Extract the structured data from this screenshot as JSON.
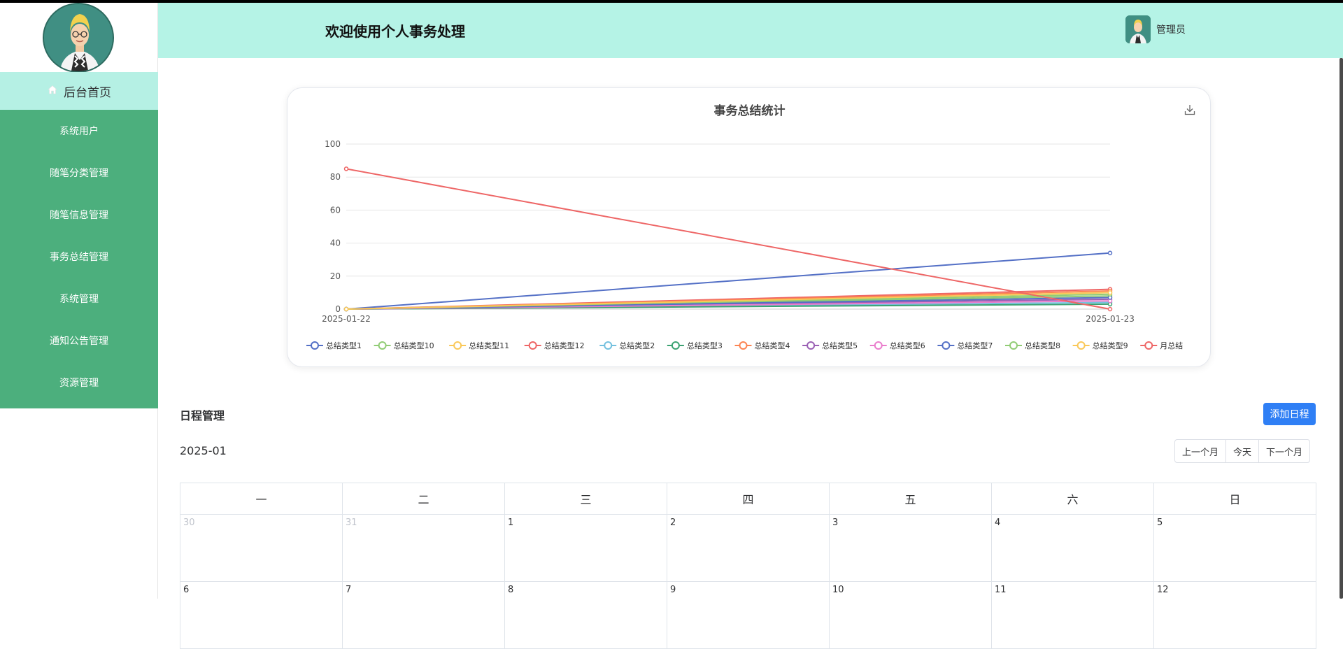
{
  "sidebar": {
    "home_label": "后台首页",
    "items": [
      {
        "label": "系统用户"
      },
      {
        "label": "随笔分类管理"
      },
      {
        "label": "随笔信息管理"
      },
      {
        "label": "事务总结管理"
      },
      {
        "label": "系统管理"
      },
      {
        "label": "通知公告管理"
      },
      {
        "label": "资源管理"
      }
    ]
  },
  "header": {
    "title": "欢迎使用个人事务处理",
    "user_name": "管理员"
  },
  "chart_data": {
    "type": "line",
    "title": "事务总结统计",
    "x": [
      "2025-01-22",
      "2025-01-23"
    ],
    "ylim": [
      0,
      100
    ],
    "yticks": [
      0,
      20,
      40,
      60,
      80,
      100
    ],
    "grid": true,
    "legend_position": "bottom",
    "series": [
      {
        "name": "总结类型1",
        "values": [
          0,
          34
        ],
        "color": "#5470c6"
      },
      {
        "name": "总结类型10",
        "values": [
          0,
          8
        ],
        "color": "#91cc75"
      },
      {
        "name": "总结类型11",
        "values": [
          0,
          10
        ],
        "color": "#fac858"
      },
      {
        "name": "总结类型12",
        "values": [
          0,
          12
        ],
        "color": "#ee6666"
      },
      {
        "name": "总结类型2",
        "values": [
          0,
          4
        ],
        "color": "#73c0de"
      },
      {
        "name": "总结类型3",
        "values": [
          0,
          3
        ],
        "color": "#3ba272"
      },
      {
        "name": "总结类型4",
        "values": [
          0,
          11
        ],
        "color": "#fc8452"
      },
      {
        "name": "总结类型5",
        "values": [
          0,
          6
        ],
        "color": "#9a60b4"
      },
      {
        "name": "总结类型6",
        "values": [
          0,
          5
        ],
        "color": "#ea7ccc"
      },
      {
        "name": "总结类型7",
        "values": [
          0,
          7
        ],
        "color": "#5470c6"
      },
      {
        "name": "总结类型8",
        "values": [
          0,
          9
        ],
        "color": "#91cc75"
      },
      {
        "name": "总结类型9",
        "values": [
          0,
          10
        ],
        "color": "#fac858"
      },
      {
        "name": "月总结",
        "values": [
          85,
          0
        ],
        "color": "#ee6666"
      }
    ]
  },
  "schedule": {
    "title": "日程管理",
    "add_button": "添加日程",
    "month": "2025-01",
    "prev_label": "上一个月",
    "today_label": "今天",
    "next_label": "下一个月",
    "weekdays": [
      "一",
      "二",
      "三",
      "四",
      "五",
      "六",
      "日"
    ],
    "weeks": [
      [
        {
          "d": "30",
          "other": true
        },
        {
          "d": "31",
          "other": true
        },
        {
          "d": "1"
        },
        {
          "d": "2"
        },
        {
          "d": "3"
        },
        {
          "d": "4"
        },
        {
          "d": "5"
        }
      ],
      [
        {
          "d": "6"
        },
        {
          "d": "7"
        },
        {
          "d": "8"
        },
        {
          "d": "9"
        },
        {
          "d": "10"
        },
        {
          "d": "11"
        },
        {
          "d": "12"
        }
      ]
    ]
  }
}
